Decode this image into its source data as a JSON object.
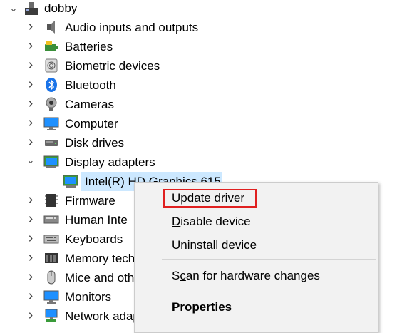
{
  "tree": {
    "root": {
      "label": "dobby",
      "icon": "computer-tower-icon"
    },
    "items": [
      {
        "label": "Audio inputs and outputs",
        "icon": "speaker-icon"
      },
      {
        "label": "Batteries",
        "icon": "battery-icon"
      },
      {
        "label": "Biometric devices",
        "icon": "fingerprint-icon"
      },
      {
        "label": "Bluetooth",
        "icon": "bluetooth-icon"
      },
      {
        "label": "Cameras",
        "icon": "webcam-icon"
      },
      {
        "label": "Computer",
        "icon": "monitor-icon"
      },
      {
        "label": "Disk drives",
        "icon": "disk-drive-icon"
      },
      {
        "label": "Display adapters",
        "icon": "display-adapter-icon",
        "expanded": true
      },
      {
        "label": "Intel(R) HD Graphics 615",
        "icon": "display-adapter-icon",
        "child": true,
        "selected": true
      },
      {
        "label": "Firmware",
        "icon": "chip-icon"
      },
      {
        "label": "Human Inte",
        "icon": "hid-icon"
      },
      {
        "label": "Keyboards",
        "icon": "keyboard-icon"
      },
      {
        "label": "Memory tech",
        "icon": "memory-icon"
      },
      {
        "label": "Mice and oth",
        "icon": "mouse-icon"
      },
      {
        "label": "Monitors",
        "icon": "monitor-icon"
      },
      {
        "label": "Network adap",
        "icon": "network-icon"
      }
    ]
  },
  "context_menu": {
    "items": [
      {
        "pre": "",
        "key": "U",
        "post": "pdate driver",
        "bold": false
      },
      {
        "pre": "",
        "key": "D",
        "post": "isable device",
        "bold": false
      },
      {
        "pre": "",
        "key": "U",
        "post": "ninstall device",
        "bold": false
      },
      {
        "pre": "S",
        "key": "c",
        "post": "an for hardware changes",
        "bold": false
      },
      {
        "pre": "P",
        "key": "r",
        "post": "operties",
        "bold": true
      }
    ]
  },
  "colors": {
    "selection": "#cce8ff",
    "menu_bg": "#f2f2f2",
    "highlight_box": "#e02020"
  }
}
